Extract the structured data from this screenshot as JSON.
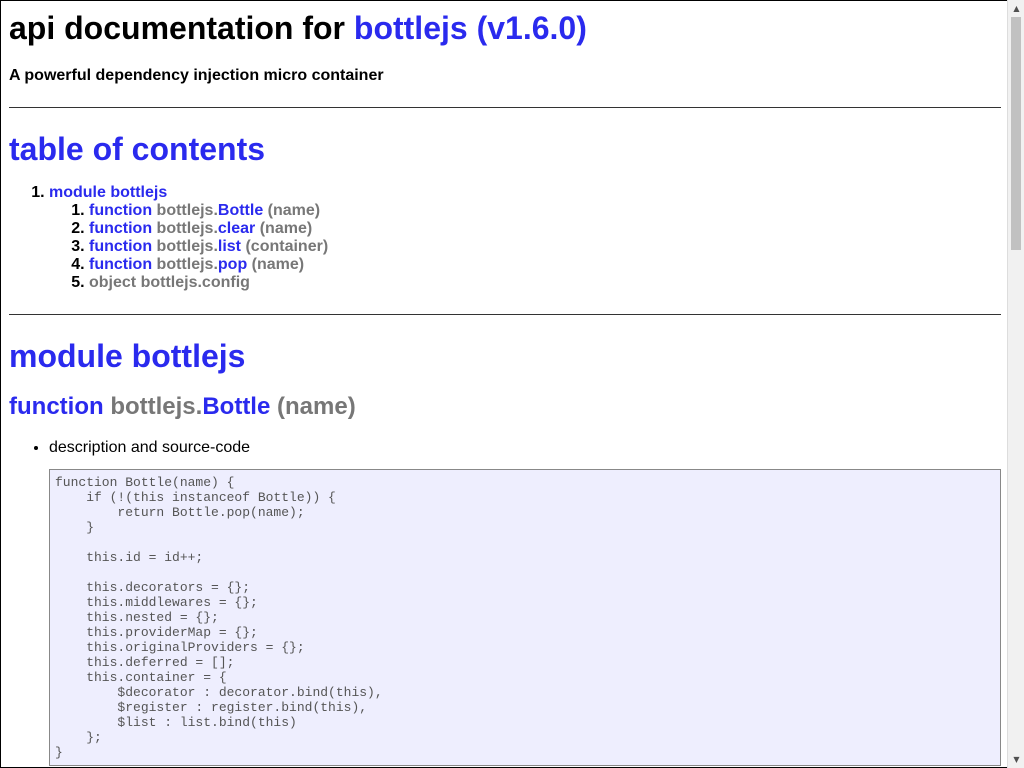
{
  "header": {
    "title_prefix": "api documentation for ",
    "title_link": "bottlejs (v1.6.0)",
    "subtitle": "A powerful dependency injection micro container"
  },
  "toc": {
    "heading": "table of contents",
    "module": "module bottlejs",
    "items": [
      {
        "kind": "function",
        "ns": "bottlejs.",
        "name": "Bottle",
        "args": "(name)"
      },
      {
        "kind": "function",
        "ns": "bottlejs.",
        "name": "clear",
        "args": "(name)"
      },
      {
        "kind": "function",
        "ns": "bottlejs.",
        "name": "list",
        "args": "(container)"
      },
      {
        "kind": "function",
        "ns": "bottlejs.",
        "name": "pop",
        "args": "(name)"
      },
      {
        "kind": "object",
        "ns": "bottlejs.config",
        "name": "",
        "args": ""
      }
    ]
  },
  "module_section": {
    "heading": "module bottlejs",
    "fn_kind": "function",
    "fn_ns": "bottlejs.",
    "fn_name": "Bottle",
    "fn_args": "(name)",
    "bullet": "description and source-code",
    "code": "function Bottle(name) {\n    if (!(this instanceof Bottle)) {\n        return Bottle.pop(name);\n    }\n\n    this.id = id++;\n\n    this.decorators = {};\n    this.middlewares = {};\n    this.nested = {};\n    this.providerMap = {};\n    this.originalProviders = {};\n    this.deferred = [];\n    this.container = {\n        $decorator : decorator.bind(this),\n        $register : register.bind(this),\n        $list : list.bind(this)\n    };\n}"
  },
  "colors": {
    "accent": "#2a2aee",
    "muted": "#777777",
    "code_bg": "#eeeefe"
  }
}
